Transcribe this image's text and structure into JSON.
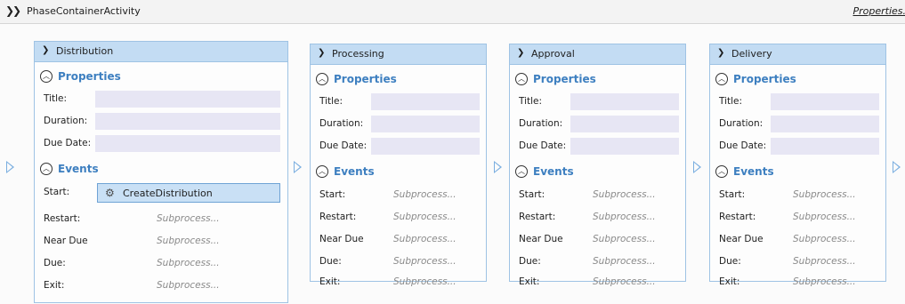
{
  "container": {
    "title": "PhaseContainerActivity",
    "properties_link": "Properties..."
  },
  "labels": {
    "properties": "Properties",
    "events": "Events",
    "title": "Title:",
    "duration": "Duration:",
    "due_date": "Due Date:",
    "start": "Start:",
    "restart": "Restart:",
    "near_due": "Near Due",
    "due": "Due:",
    "exit": "Exit:",
    "subprocess": "Subprocess..."
  },
  "phases": [
    {
      "name": "Distribution",
      "start_activity": "CreateDistribution"
    },
    {
      "name": "Processing"
    },
    {
      "name": "Approval"
    },
    {
      "name": "Delivery"
    }
  ],
  "colors": {
    "header_bg": "#c3dcf3",
    "border": "#9fc3e4",
    "section_label": "#3d7fc0",
    "input_bg": "#e7e6f4"
  }
}
